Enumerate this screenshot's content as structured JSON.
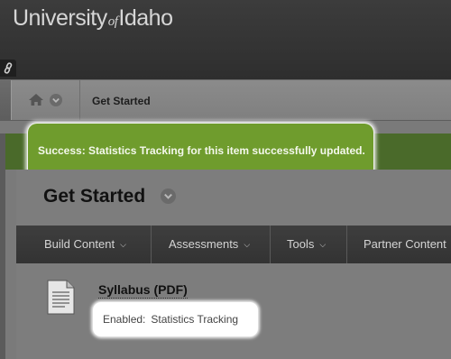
{
  "header": {
    "logo_main": "University",
    "logo_of": "of",
    "logo_end": "Idaho",
    "link_icon": "link-icon"
  },
  "breadcrumb": {
    "home_icon": "home-icon",
    "menu_icon": "chevron-down-icon",
    "current": "Get Started"
  },
  "alert": {
    "message": "Success: Statistics Tracking for this item successfully updated.",
    "color": "#6f9c2d"
  },
  "content": {
    "title": "Get Started",
    "menu": [
      {
        "label": "Build Content"
      },
      {
        "label": "Assessments"
      },
      {
        "label": "Tools"
      },
      {
        "label": "Partner Content"
      }
    ],
    "item": {
      "title": "Syllabus (PDF)",
      "icon": "document-icon",
      "status_label": "Enabled:",
      "status_value": "Statistics Tracking"
    }
  }
}
